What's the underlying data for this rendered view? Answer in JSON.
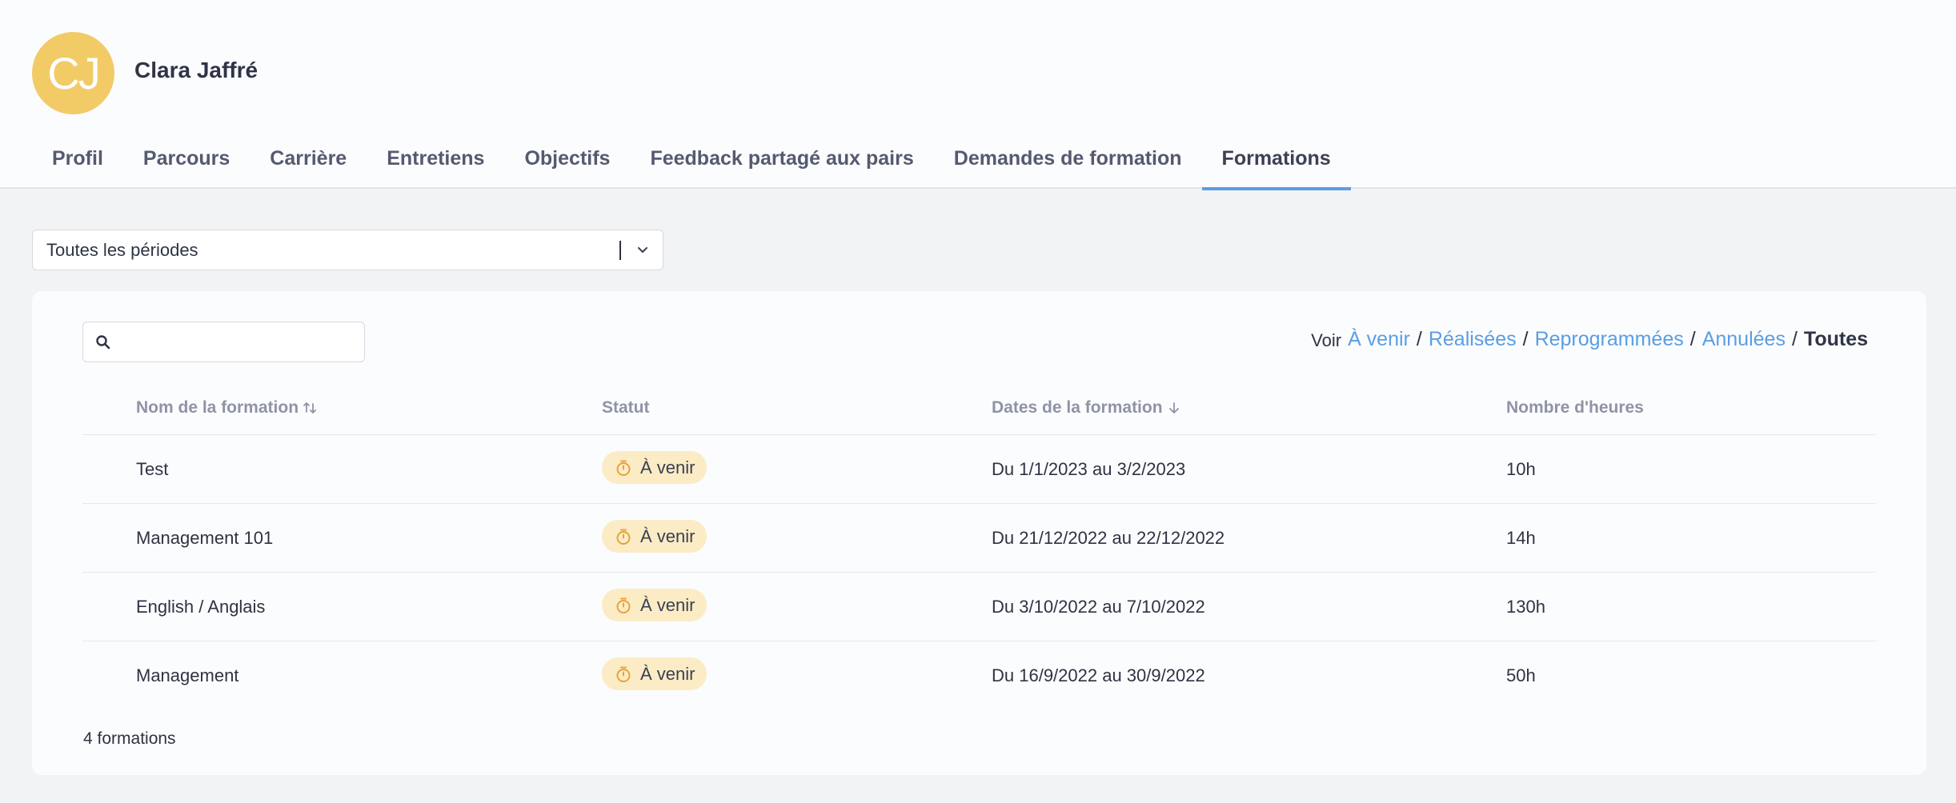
{
  "user": {
    "initials": "CJ",
    "name": "Clara Jaffré"
  },
  "tabs": [
    {
      "label": "Profil"
    },
    {
      "label": "Parcours"
    },
    {
      "label": "Carrière"
    },
    {
      "label": "Entretiens"
    },
    {
      "label": "Objectifs"
    },
    {
      "label": "Feedback partagé aux pairs"
    },
    {
      "label": "Demandes de formation"
    },
    {
      "label": "Formations",
      "active": true
    }
  ],
  "period_select": {
    "value": "Toutes les périodes"
  },
  "search": {
    "placeholder": ""
  },
  "filter": {
    "prefix": "Voir",
    "options": [
      "À venir",
      "Réalisées",
      "Reprogrammées",
      "Annulées",
      "Toutes"
    ],
    "selected": "Toutes",
    "separator": "/"
  },
  "table": {
    "columns": [
      "Nom de la formation",
      "Statut",
      "Dates de la formation",
      "Nombre d'heures"
    ],
    "rows": [
      {
        "name": "Test",
        "status": "À venir",
        "dates": "Du 1/1/2023 au 3/2/2023",
        "hours": "10h"
      },
      {
        "name": "Management 101",
        "status": "À venir",
        "dates": "Du 21/12/2022 au 22/12/2022",
        "hours": "14h"
      },
      {
        "name": "English / Anglais",
        "status": "À venir",
        "dates": "Du 3/10/2022 au 7/10/2022",
        "hours": "130h"
      },
      {
        "name": "Management",
        "status": "À venir",
        "dates": "Du 16/9/2022 au 30/9/2022",
        "hours": "50h"
      }
    ]
  },
  "footer": {
    "count": "4 formations"
  },
  "colors": {
    "accent": "#5a9ee3",
    "avatar": "#f2cb67",
    "badge_bg": "#fbecc6",
    "badge_icon": "#e9a23b"
  },
  "icons": {
    "search": "search-icon",
    "chevron": "chevron-down-icon",
    "sort": "sort-icon",
    "sort_desc": "arrow-down-icon",
    "status": "timer-icon"
  }
}
